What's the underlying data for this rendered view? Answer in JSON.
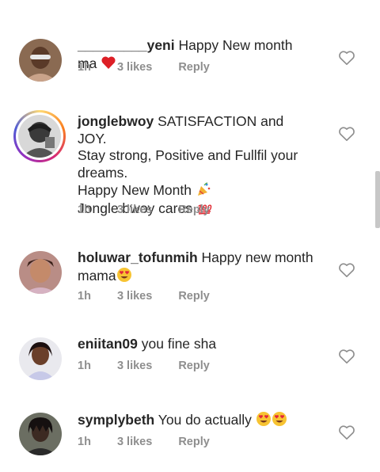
{
  "comments": [
    {
      "username": "_________yeni",
      "lines": [
        "Happy New month ma"
      ],
      "emoji_after_last_line": [
        "red-heart-emoji"
      ],
      "time": "1h",
      "likes": "3 likes",
      "reply": "Reply"
    },
    {
      "username": "jonglebwoy",
      "lines": [
        "SATISFACTION and JOY.",
        "Stay strong, Positive and Fullfil your",
        "dreams.",
        "Happy New Month",
        "Jongle bwoy cares"
      ],
      "time": "1h",
      "likes": "3 likes",
      "reply": "Reply"
    },
    {
      "username": "holuwar_tofunmih",
      "lines": [
        "Happy new month",
        "mama"
      ],
      "time": "1h",
      "likes": "3 likes",
      "reply": "Reply"
    },
    {
      "username": "eniitan09",
      "lines": [
        "you fine sha"
      ],
      "time": "1h",
      "likes": "3 likes",
      "reply": "Reply"
    },
    {
      "username": "symplybeth",
      "lines": [
        "You do actually"
      ],
      "time": "1h",
      "likes": "3 likes",
      "reply": "Reply"
    }
  ],
  "icons": {
    "like": "heart-outline-icon",
    "emojis": [
      "red-heart-emoji",
      "party-popper-emoji",
      "hundred-points-emoji",
      "heart-eyes-emoji"
    ]
  },
  "colors": {
    "text": "#262626",
    "meta": "#8e8e8e",
    "heart_red": "#ed1c24"
  }
}
